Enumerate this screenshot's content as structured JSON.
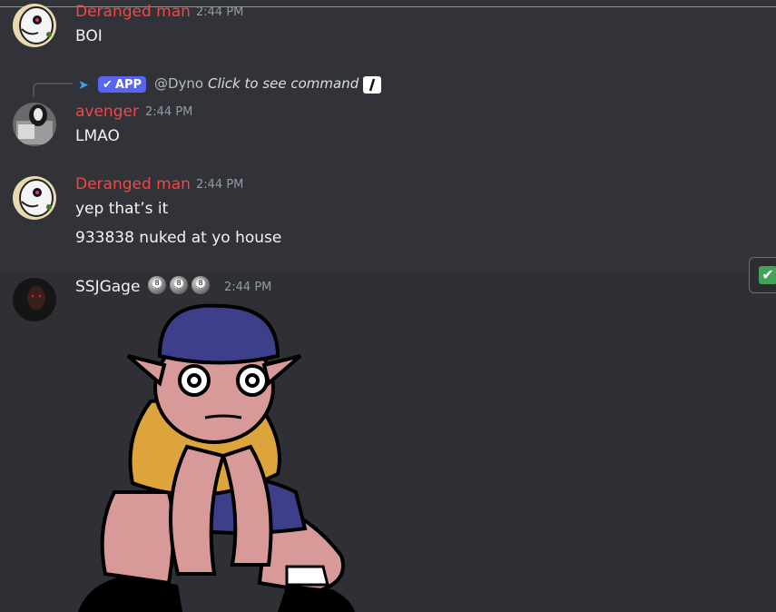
{
  "messages": [
    {
      "author": "Deranged man",
      "time": "2:44 PM",
      "lines": [
        "BOI"
      ]
    },
    {
      "reply": {
        "app_badge": "APP",
        "mention": "@Dyno",
        "command": "Click to see command"
      },
      "author": "avenger",
      "time": "2:44 PM",
      "lines": [
        "LMAO"
      ]
    },
    {
      "author": "Deranged man",
      "time": "2:44 PM",
      "lines": [
        "yep that’s it",
        "933838 nuked at yo house"
      ]
    },
    {
      "author": "SSJGage",
      "time": "2:44 PM",
      "badges": [
        "8-ball-icon",
        "8-ball-icon",
        "8-ball-icon"
      ],
      "attachment": "cartoon-character-image"
    }
  ],
  "colors": {
    "background": "#313338",
    "author_red": "#f04747",
    "app_badge": "#5865f2",
    "timestamp": "#949ba4",
    "check": "#43a25a"
  },
  "side_icon": "check-mark-icon"
}
